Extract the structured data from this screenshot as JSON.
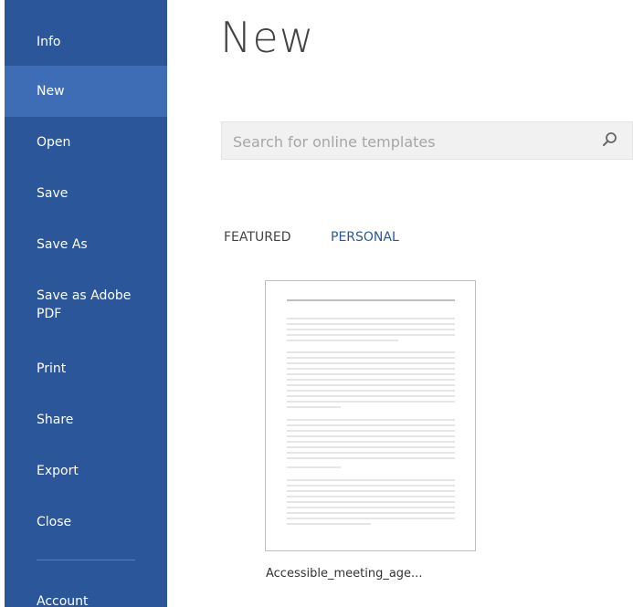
{
  "sidebar": {
    "items": [
      {
        "label": "Info",
        "active": false
      },
      {
        "label": "New",
        "active": true
      },
      {
        "label": "Open",
        "active": false
      },
      {
        "label": "Save",
        "active": false
      },
      {
        "label": "Save As",
        "active": false
      },
      {
        "label": "Save as Adobe PDF",
        "active": false
      },
      {
        "label": "Print",
        "active": false
      },
      {
        "label": "Share",
        "active": false
      },
      {
        "label": "Export",
        "active": false
      },
      {
        "label": "Close",
        "active": false
      }
    ],
    "account_label": "Account"
  },
  "main": {
    "title": "New",
    "search": {
      "placeholder": "Search for online templates",
      "value": ""
    },
    "tabs": [
      {
        "label": "FEATURED",
        "active": false
      },
      {
        "label": "PERSONAL",
        "active": true
      }
    ],
    "templates": [
      {
        "name": "Accessible_meeting_age..."
      }
    ]
  },
  "icons": {
    "search": "search-icon"
  },
  "colors": {
    "sidebar_background": "#2b579a",
    "active_item_background": "#3e6db5",
    "sidebar_text": "#ffffff",
    "title_text": "#444444",
    "accent_tab": "#2b579a",
    "search_background": "#f1f1f1",
    "placeholder_text": "#a6a6a6",
    "tile_border": "#bfbfbf"
  }
}
